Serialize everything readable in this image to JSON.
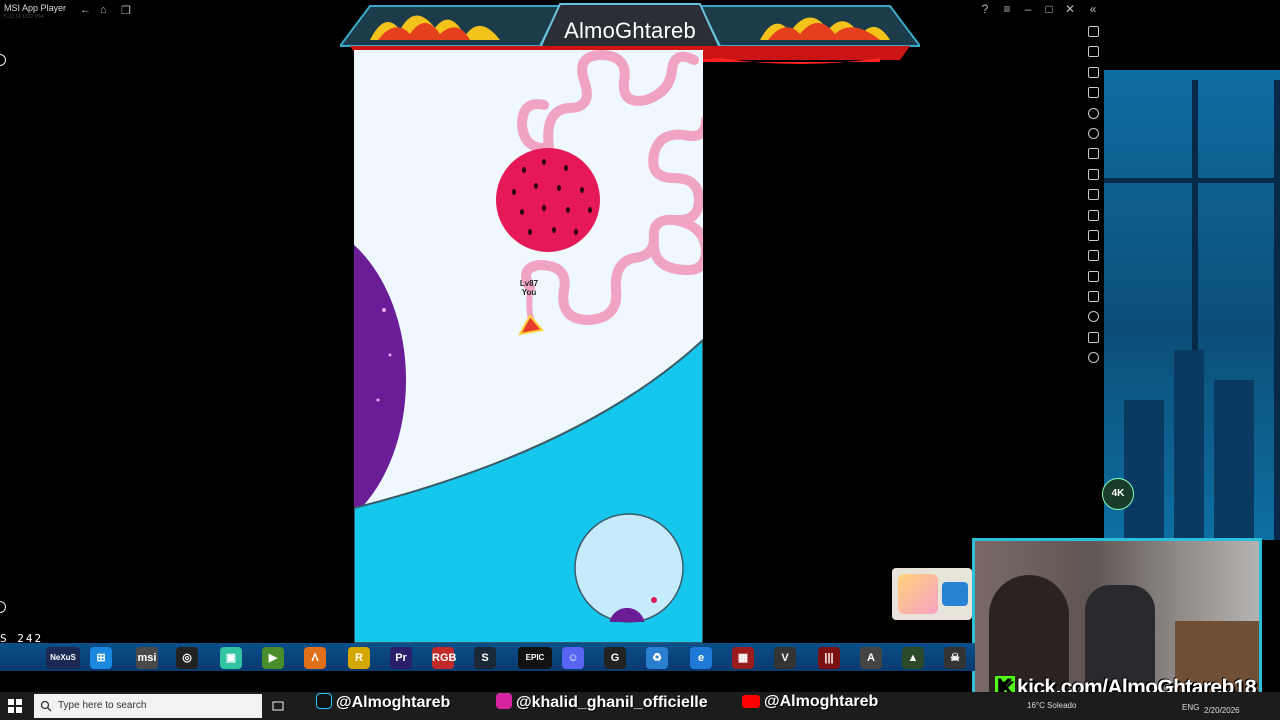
{
  "window": {
    "title": "MSI App Player",
    "version": "5.22.14.1022 P64",
    "nav": [
      "←",
      "⌂",
      "❐"
    ],
    "controls": [
      "?",
      "≡",
      "–",
      "□",
      "✕",
      "«"
    ]
  },
  "banner": {
    "channel_name": "AlmoGhtareb"
  },
  "game": {
    "player_level": "Lv87",
    "player_name": "You"
  },
  "left_panel": {
    "counter_text": "S 242"
  },
  "badge": {
    "label": "4K"
  },
  "stream_overlay": {
    "kick_url": "kick.com/AlmoGhtareb18",
    "kick_letter": "K"
  },
  "social": [
    {
      "handle": "@Almoghtareb",
      "icon": "tiktok-icon",
      "color": "#111111"
    },
    {
      "handle": "@khalid_ghanil_officielle",
      "icon": "instagram-icon",
      "color": "#d6249f"
    },
    {
      "handle": "@Almoghtareb",
      "icon": "youtube-icon",
      "color": "#ff0000"
    }
  ],
  "taskbar": {
    "search_placeholder": "Type here to search",
    "weather": "16°C Soleado",
    "language": "ENG",
    "date": "2/20/2026"
  },
  "app_strip": [
    {
      "label": "NeXuS",
      "icon": "nexus-icon",
      "color": "#1a2a55"
    },
    {
      "label": "⊞",
      "icon": "windows-icon",
      "color": "#1b88e0"
    },
    {
      "label": "msi",
      "icon": "msi-center-icon",
      "color": "#4a4a4a"
    },
    {
      "label": "◎",
      "icon": "obs-icon",
      "color": "#222222"
    },
    {
      "label": "▣",
      "icon": "streamlabs-icon",
      "color": "#31c3a2"
    },
    {
      "label": "▶",
      "icon": "play-icon",
      "color": "#4a8d2b"
    },
    {
      "label": "Λ",
      "icon": "autodesk-icon",
      "color": "#e0701a"
    },
    {
      "label": "R",
      "icon": "rockstar-icon",
      "color": "#d4a800"
    },
    {
      "label": "Pr",
      "icon": "premiere-icon",
      "color": "#2a1f6a"
    },
    {
      "label": "RGB",
      "icon": "rgb-icon",
      "color": "#c22a2a"
    },
    {
      "label": "S",
      "icon": "steam-icon",
      "color": "#1b2838"
    },
    {
      "label": "EPIC",
      "icon": "epic-games-icon",
      "color": "#111111"
    },
    {
      "label": "☺",
      "icon": "discord-icon",
      "color": "#5865f2"
    },
    {
      "label": "G",
      "icon": "logitech-icon",
      "color": "#222222"
    },
    {
      "label": "♻",
      "icon": "recycle-bin-icon",
      "color": "#2a7fd1"
    },
    {
      "label": "e",
      "icon": "edge-icon",
      "color": "#1f7ad6"
    },
    {
      "label": "▦",
      "icon": "game-icon",
      "color": "#9a1c1c"
    },
    {
      "label": "V",
      "icon": "gta-icon",
      "color": "#333333"
    },
    {
      "label": "|||",
      "icon": "diablo-icon",
      "color": "#7a1010"
    },
    {
      "label": "A",
      "icon": "assassins-icon",
      "color": "#444444"
    },
    {
      "label": "▲",
      "icon": "ark-icon",
      "color": "#2a4a2a"
    },
    {
      "label": "☠",
      "icon": "skull-icon",
      "color": "#333333"
    }
  ]
}
